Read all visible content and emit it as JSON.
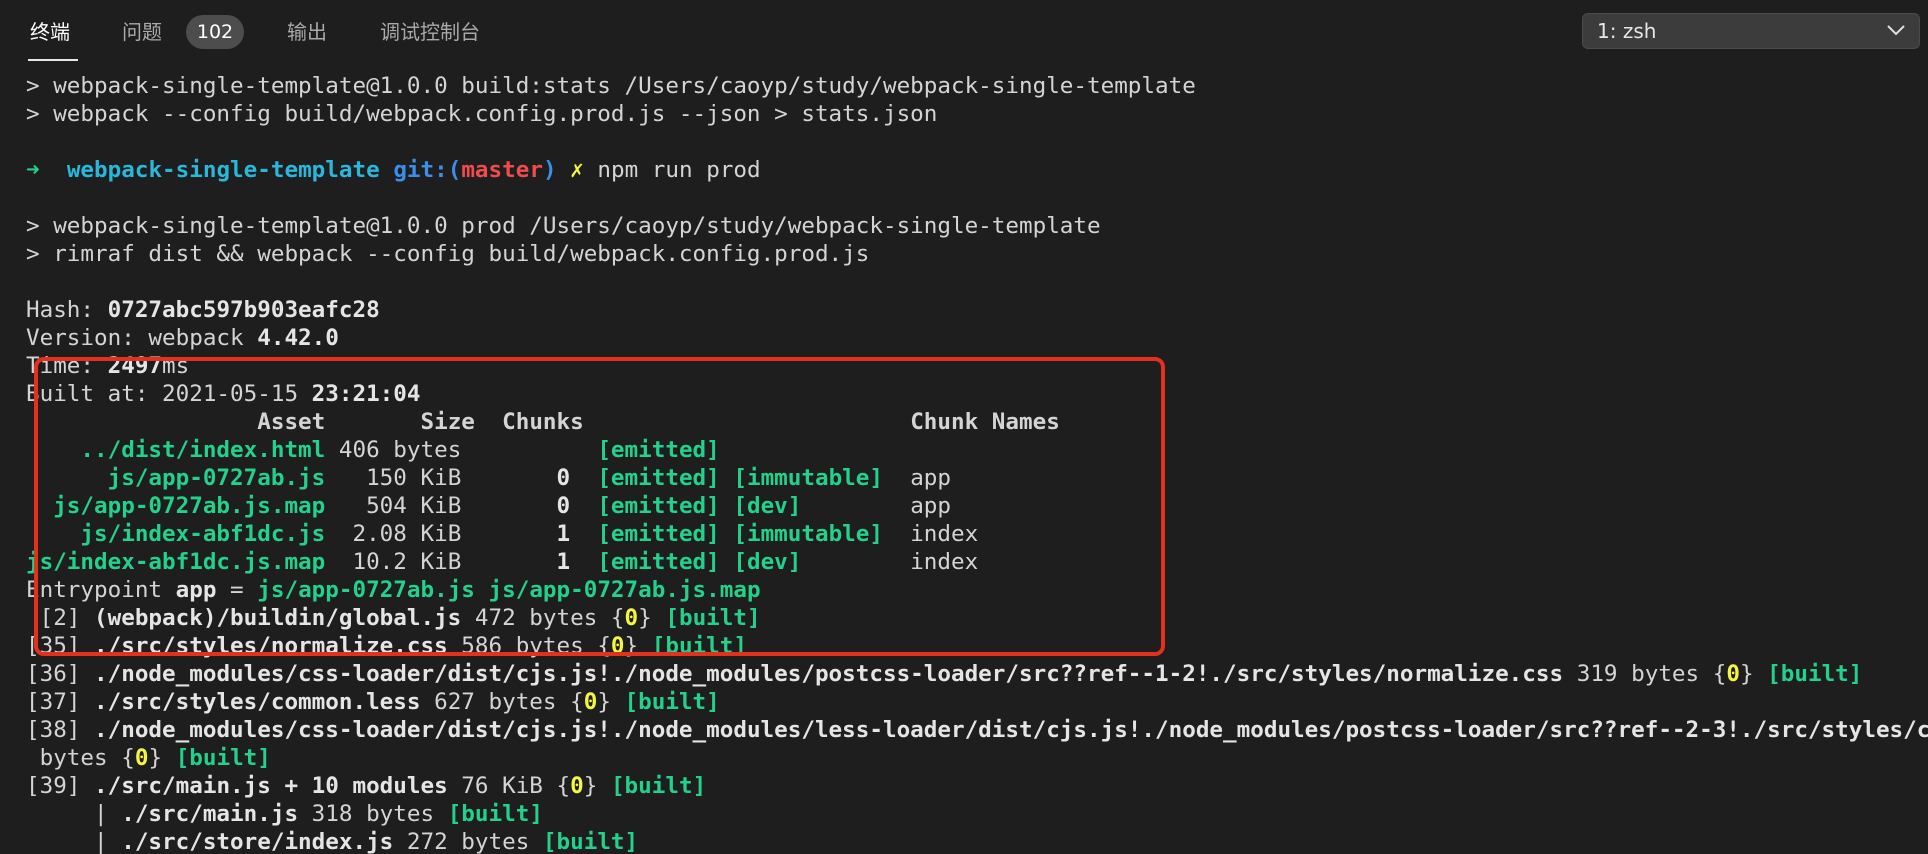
{
  "tabs": [
    {
      "label": "终端",
      "active": true
    },
    {
      "label": "问题",
      "active": false
    },
    {
      "label": "输出",
      "active": false
    },
    {
      "label": "调试控制台",
      "active": false
    }
  ],
  "problems_count": "102",
  "terminal_select": {
    "value": "1: zsh"
  },
  "terminal": {
    "l1": "> webpack-single-template@1.0.0 build:stats /Users/caoyp/study/webpack-single-template",
    "l2": "> webpack --config build/webpack.config.prod.js --json > stats.json",
    "prompt": {
      "arrow": "➜",
      "dir": "webpack-single-template",
      "git_open": "git:(",
      "branch": "master",
      "git_close": ")",
      "dirty": "✗",
      "command": "npm run prod"
    },
    "l5": "> webpack-single-template@1.0.0 prod /Users/caoyp/study/webpack-single-template",
    "l6": "> rimraf dist && webpack --config build/webpack.config.prod.js",
    "hash_label": "Hash: ",
    "hash_value": "0727abc597b903eafc28",
    "version_label": "Version: webpack ",
    "version_value": "4.42.0",
    "time_label": "Time: ",
    "time_value": "2497",
    "time_unit": "ms",
    "built_label": "Built at: 2021-05-15 ",
    "built_time": "23:21:04",
    "header_asset": "Asset",
    "header_size": "Size",
    "header_chunks": "Chunks",
    "header_names": "Chunk Names",
    "assets": [
      {
        "asset": "../dist/index.html",
        "size": "406 bytes",
        "chunks": "",
        "emitted": "[emitted]",
        "flag": "",
        "name": ""
      },
      {
        "asset": "js/app-0727ab.js",
        "size": "150 KiB",
        "chunks": "0",
        "emitted": "[emitted]",
        "flag": "[immutable]",
        "name": "app"
      },
      {
        "asset": "js/app-0727ab.js.map",
        "size": "504 KiB",
        "chunks": "0",
        "emitted": "[emitted]",
        "flag": "[dev]",
        "name": "app"
      },
      {
        "asset": "js/index-abf1dc.js",
        "size": "2.08 KiB",
        "chunks": "1",
        "emitted": "[emitted]",
        "flag": "[immutable]",
        "name": "index"
      },
      {
        "asset": "js/index-abf1dc.js.map",
        "size": "10.2 KiB",
        "chunks": "1",
        "emitted": "[emitted]",
        "flag": "[dev]",
        "name": "index"
      }
    ],
    "entry_label": "Entrypoint ",
    "entry_name": "app",
    "entry_eq": " = ",
    "entry_files": "js/app-0727ab.js js/app-0727ab.js.map",
    "modules": [
      {
        "id": " [2] ",
        "path": "(webpack)/buildin/global.js",
        "size": " 472 bytes {",
        "chunk": "0",
        "close": "} ",
        "status": "[built]"
      },
      {
        "id": "[35] ",
        "path": "./src/styles/normalize.css",
        "size": " 586 bytes {",
        "chunk": "0",
        "close": "} ",
        "status": "[built]"
      },
      {
        "id": "[36] ",
        "path": "./node_modules/css-loader/dist/cjs.js!./node_modules/postcss-loader/src??ref--1-2!./src/styles/normalize.css",
        "size": " 319 bytes {",
        "chunk": "0",
        "close": "} ",
        "status": "[built]"
      },
      {
        "id": "[37] ",
        "path": "./src/styles/common.less",
        "size": " 627 bytes {",
        "chunk": "0",
        "close": "} ",
        "status": "[built]"
      },
      {
        "id": "[38] ",
        "path": "./node_modules/css-loader/dist/cjs.js!./node_modules/less-loader/dist/cjs.js!./node_modules/postcss-loader/src??ref--2-3!./src/styles/common.less",
        "size": "",
        "chunk": "",
        "close": "",
        "status": ""
      }
    ],
    "wrap_pre": " bytes {",
    "wrap_chunk": "0",
    "wrap_close": "} ",
    "wrap_status": "[built]",
    "m39_id": "[39] ",
    "m39_path": "./src/main.js + 10 modules",
    "m39_size": " 76 KiB {",
    "m39_chunk": "0",
    "m39_close": "} ",
    "m39_status": "[built]",
    "sub1_pipe": "     | ",
    "sub1_path": "./src/main.js",
    "sub1_size": " 318 bytes ",
    "sub1_status": "[built]",
    "sub2_pipe": "     | ",
    "sub2_path": "./src/store/index.js",
    "sub2_size": " 272 bytes ",
    "sub2_status": "[built]"
  },
  "colors": {
    "background": "#1e1e1e",
    "green": "#23d18b",
    "cyan": "#29b8db",
    "red": "#f14c4c",
    "yellow": "#f5f543",
    "highlight_border": "#e4301c"
  }
}
